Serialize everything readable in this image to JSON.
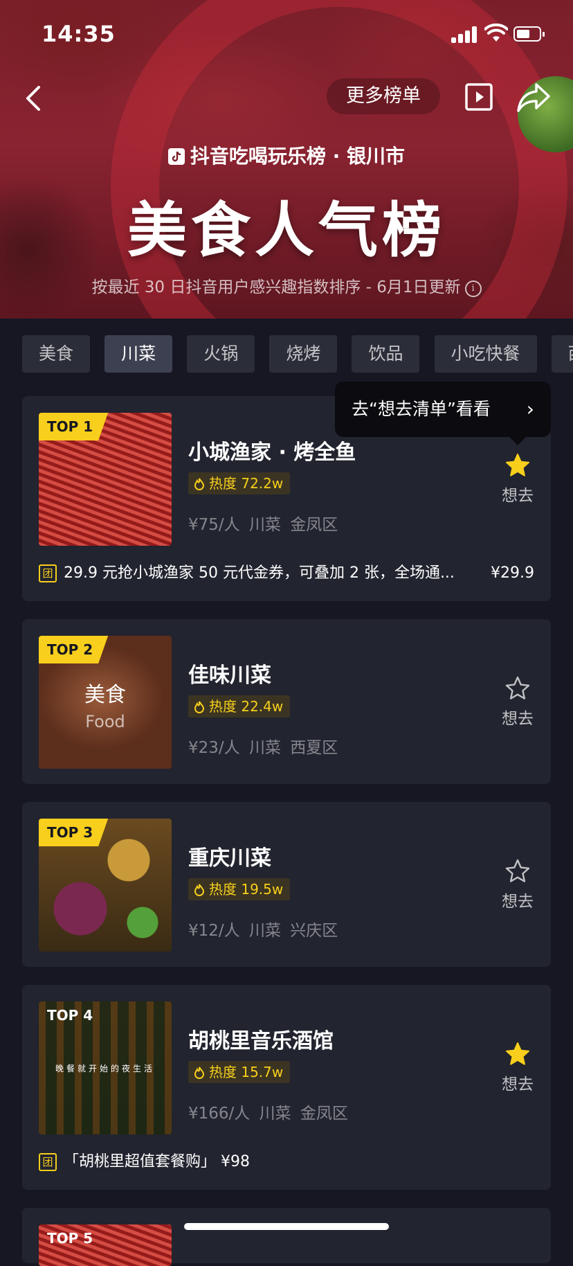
{
  "status_bar": {
    "time": "14:35"
  },
  "header": {
    "more_lists_label": "更多榜单",
    "brand": "抖音吃喝玩乐榜 · 银川市",
    "title": "美食人气榜",
    "subtitle": "按最近 30 日抖音用户感兴趣指数排序 - 6月1日更新"
  },
  "tabs": [
    "美食",
    "川菜",
    "火锅",
    "烧烤",
    "饮品",
    "小吃快餐",
    "西"
  ],
  "active_tab": "川菜",
  "tooltip": {
    "text": "去“想去清单”看看"
  },
  "want_label": "想去",
  "colors": {
    "accent": "#f8cf1c",
    "background": "#161722",
    "card": "#22242f"
  },
  "items": [
    {
      "rank": "TOP 1",
      "name": "小城渔家 · 烤全鱼",
      "heat": "热度 72.2w",
      "price": "¥75/人",
      "cuisine": "川菜",
      "district": "金凤区",
      "wanted": true,
      "deal": {
        "tag": "团",
        "text": "29.9 元抢小城渔家 50 元代金券，可叠加 2 张，全场通...",
        "price": "¥29.9"
      }
    },
    {
      "rank": "TOP 2",
      "name": "佳味川菜",
      "heat": "热度 22.4w",
      "price": "¥23/人",
      "cuisine": "川菜",
      "district": "西夏区",
      "wanted": false,
      "image_text": {
        "cn": "美食",
        "en": "Food"
      }
    },
    {
      "rank": "TOP 3",
      "name": "重庆川菜",
      "heat": "热度 19.5w",
      "price": "¥12/人",
      "cuisine": "川菜",
      "district": "兴庆区",
      "wanted": false
    },
    {
      "rank": "TOP 4",
      "name": "胡桃里音乐酒馆",
      "heat": "热度 15.7w",
      "price": "¥166/人",
      "cuisine": "川菜",
      "district": "金凤区",
      "wanted": true,
      "image_text": {
        "strip": "晚餐就开始的夜生活"
      },
      "deal": {
        "tag": "团",
        "text": "「胡桃里超值套餐购」 ¥98",
        "price": ""
      }
    },
    {
      "rank": "TOP 5"
    }
  ]
}
